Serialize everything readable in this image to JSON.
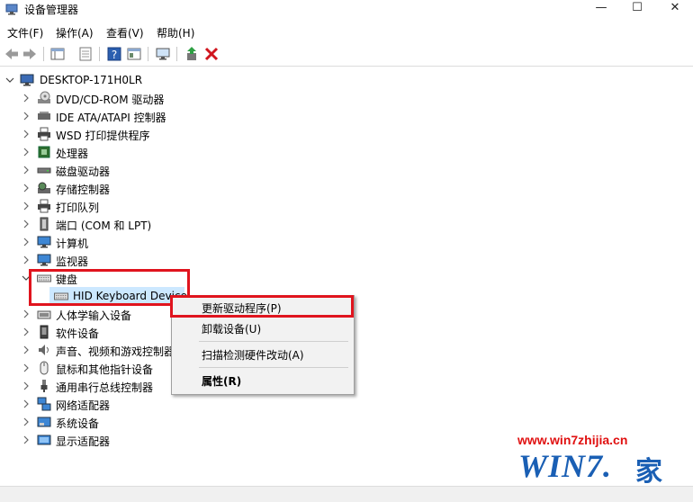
{
  "window": {
    "title": "设备管理器",
    "controls": {
      "minimize": "—",
      "maximize": "☐",
      "close": "✕"
    }
  },
  "menu": [
    "文件(F)",
    "操作(A)",
    "查看(V)",
    "帮助(H)"
  ],
  "toolbar": {
    "icons": [
      "back-arrow-icon",
      "forward-arrow-icon",
      "properties-grid-icon",
      "document-icon",
      "help-icon",
      "panel-icon",
      "monitor-scan-icon",
      "update-driver-icon",
      "uninstall-x-icon"
    ]
  },
  "tree": {
    "root": "DESKTOP-171H0LR",
    "categories": [
      {
        "label": "DVD/CD-ROM 驱动器",
        "icon": "dvd-drive-icon",
        "expanded": false
      },
      {
        "label": "IDE ATA/ATAPI 控制器",
        "icon": "ide-controller-icon",
        "expanded": false
      },
      {
        "label": "WSD 打印提供程序",
        "icon": "printer-icon",
        "expanded": false
      },
      {
        "label": "处理器",
        "icon": "cpu-icon",
        "expanded": false
      },
      {
        "label": "磁盘驱动器",
        "icon": "disk-drive-icon",
        "expanded": false
      },
      {
        "label": "存储控制器",
        "icon": "storage-controller-icon",
        "expanded": false
      },
      {
        "label": "打印队列",
        "icon": "print-queue-icon",
        "expanded": false
      },
      {
        "label": "端口 (COM 和 LPT)",
        "icon": "port-icon",
        "expanded": false
      },
      {
        "label": "计算机",
        "icon": "computer-icon",
        "expanded": false
      },
      {
        "label": "监视器",
        "icon": "monitor-icon",
        "expanded": false
      },
      {
        "label": "键盘",
        "icon": "keyboard-icon",
        "expanded": true,
        "children": [
          {
            "label": "HID Keyboard Device",
            "icon": "keyboard-icon"
          }
        ]
      },
      {
        "label": "人体学输入设备",
        "icon": "hid-icon",
        "expanded": false
      },
      {
        "label": "软件设备",
        "icon": "software-device-icon",
        "expanded": false
      },
      {
        "label": "声音、视频和游戏控制器",
        "icon": "speaker-icon",
        "expanded": false
      },
      {
        "label": "鼠标和其他指针设备",
        "icon": "mouse-icon",
        "expanded": false
      },
      {
        "label": "通用串行总线控制器",
        "icon": "usb-icon",
        "expanded": false
      },
      {
        "label": "网络适配器",
        "icon": "network-adapter-icon",
        "expanded": false
      },
      {
        "label": "系统设备",
        "icon": "system-device-icon",
        "expanded": false
      },
      {
        "label": "显示适配器",
        "icon": "display-adapter-icon",
        "expanded": false
      }
    ]
  },
  "context_menu": {
    "items": [
      {
        "label": "更新驱动程序(P)",
        "bold": false
      },
      {
        "label": "卸载设备(U)",
        "bold": false
      },
      {
        "label": "扫描检测硬件改动(A)",
        "bold": false
      },
      {
        "label": "属性(R)",
        "bold": true
      }
    ]
  },
  "watermark": {
    "url": "www.win7zhijia.cn",
    "logo": "WIN7.",
    "logo_suffix": "家"
  },
  "colors": {
    "highlight_red": "#e0141e",
    "selection_bg": "#cce8ff",
    "logo_blue": "#1a5fb4"
  }
}
